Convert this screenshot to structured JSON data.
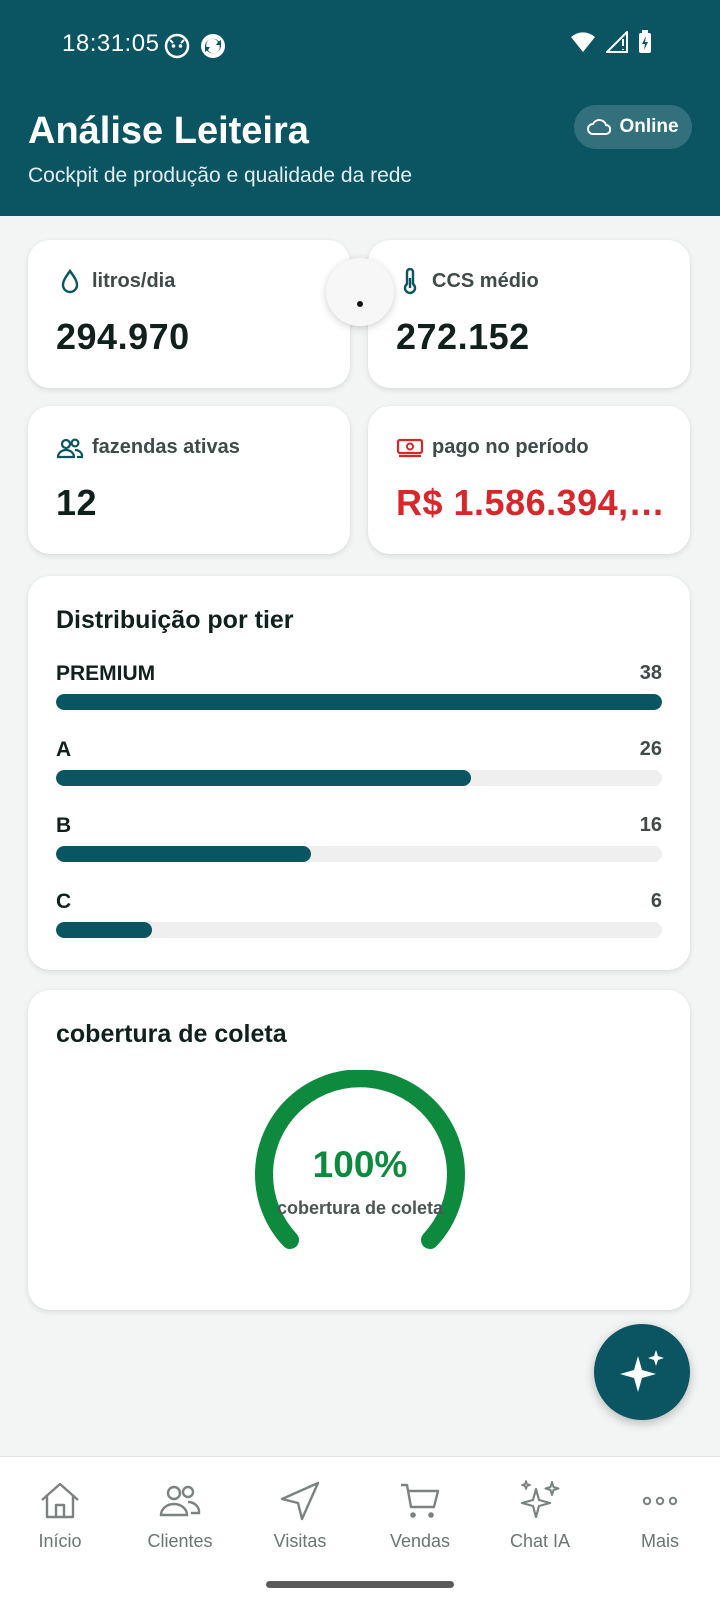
{
  "status_bar": {
    "time": "18:31:05"
  },
  "header": {
    "title": "Análise Leiteira",
    "subtitle": "Cockpit de produção e qualidade da rede",
    "online_label": "Online"
  },
  "metrics": [
    {
      "icon": "droplet-icon",
      "label": "litros/dia",
      "value": "294.970"
    },
    {
      "icon": "thermometer-icon",
      "label": "CCS médio",
      "value": "272.152"
    },
    {
      "icon": "users-icon",
      "label": "fazendas ativas",
      "value": "12"
    },
    {
      "icon": "money-icon",
      "label": "pago no período",
      "value": "R$ 1.586.394,…",
      "value_color": "#d8262b"
    }
  ],
  "tier_distribution": {
    "title": "Distribuição por tier",
    "max": 38,
    "tiers": [
      {
        "name": "PREMIUM",
        "count": "38",
        "value": 38
      },
      {
        "name": "A",
        "count": "26",
        "value": 26
      },
      {
        "name": "B",
        "count": "16",
        "value": 16
      },
      {
        "name": "C",
        "count": "6",
        "value": 6
      }
    ]
  },
  "coverage": {
    "title": "cobertura de coleta",
    "value_text": "100%",
    "value": 1.0,
    "label": "cobertura de coleta",
    "color": "#0e8a3e"
  },
  "fab": {
    "icon": "sparkles-icon"
  },
  "bottom_nav": [
    {
      "icon": "home-icon",
      "label": "Início"
    },
    {
      "icon": "users-icon",
      "label": "Clientes"
    },
    {
      "icon": "navigation-icon",
      "label": "Visitas"
    },
    {
      "icon": "cart-icon",
      "label": "Vendas"
    },
    {
      "icon": "sparkles-icon",
      "label": "Chat IA"
    },
    {
      "icon": "more-icon",
      "label": "Mais"
    }
  ],
  "colors": {
    "primary": "#0b5563",
    "danger": "#d8262b",
    "success": "#0e8a3e"
  }
}
